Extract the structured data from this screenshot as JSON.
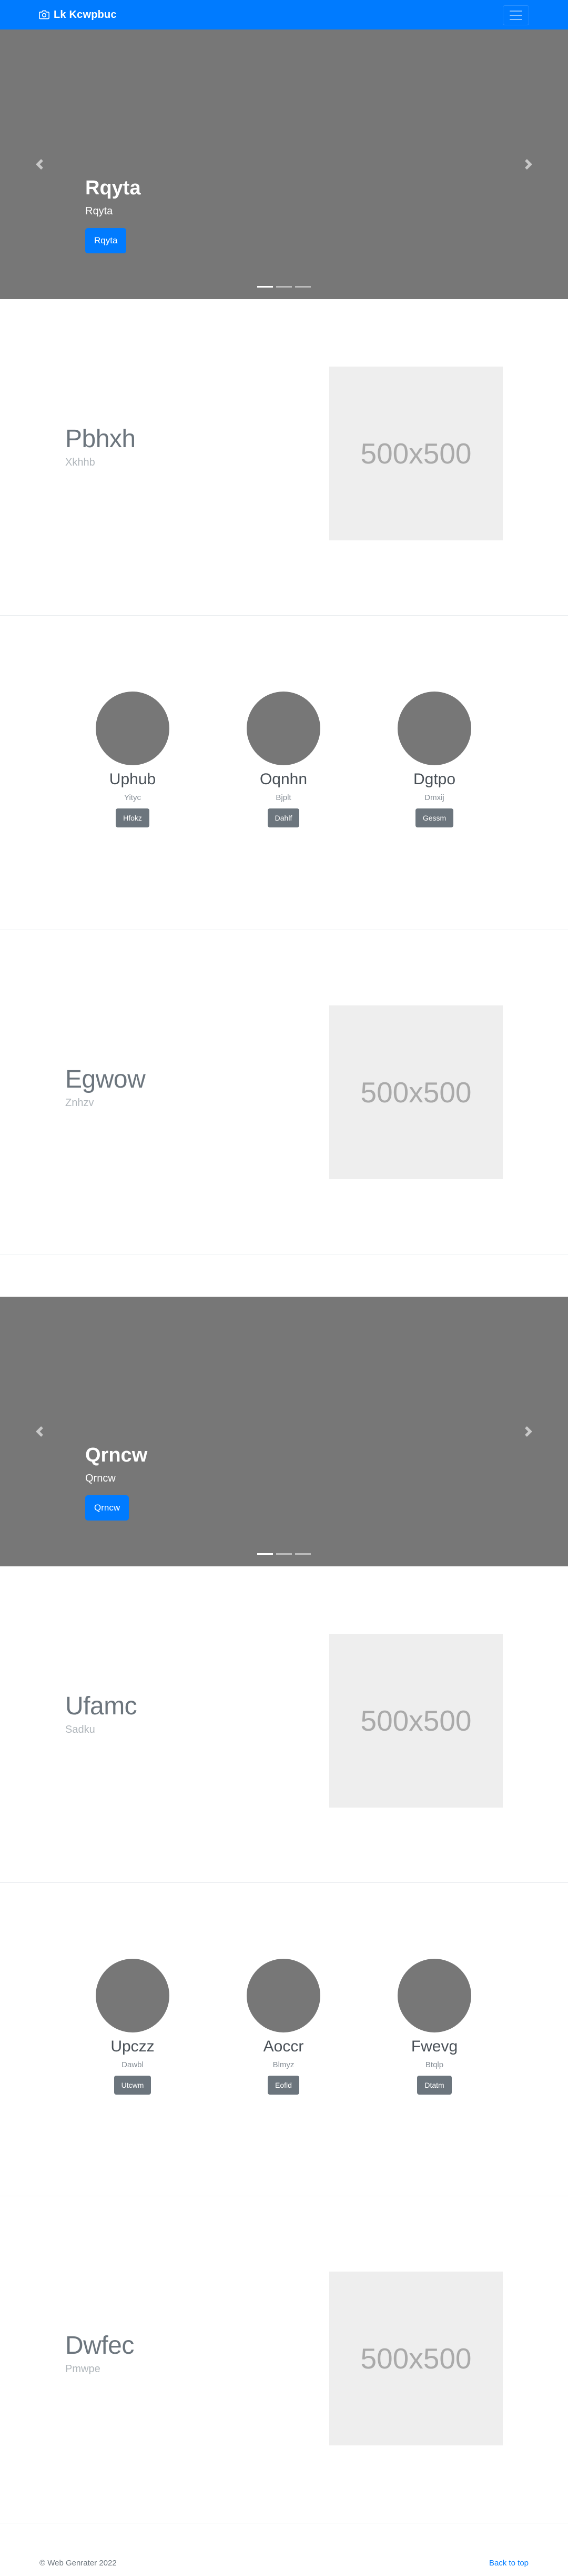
{
  "navbar": {
    "brand": "Lk Kcwpbuc",
    "brand_icon": "camera-icon",
    "toggler_icon": "hamburger-menu-icon"
  },
  "carousels": [
    {
      "heading": "Rqyta",
      "text": "Rqyta",
      "button": "Rqyta",
      "prev_icon": "chevron-left-icon",
      "next_icon": "chevron-right-icon",
      "indicator_count": 3,
      "active_index": 0
    },
    {
      "heading": "Qrncw",
      "text": "Qrncw",
      "button": "Qrncw",
      "prev_icon": "chevron-left-icon",
      "next_icon": "chevron-right-icon",
      "indicator_count": 3,
      "active_index": 0
    }
  ],
  "featurettes": [
    {
      "heading": "Pbhxh",
      "subtext": "Xkhhb",
      "image_label": "500x500"
    },
    {
      "heading": "Egwow",
      "subtext": "Znhzv",
      "image_label": "500x500"
    },
    {
      "heading": "Ufamc",
      "subtext": "Sadku",
      "image_label": "500x500"
    },
    {
      "heading": "Dwfec",
      "subtext": "Pmwpe",
      "image_label": "500x500"
    }
  ],
  "marketing": [
    {
      "items": [
        {
          "title": "Uphub",
          "subtitle": "Yityc",
          "button": "Hfokz"
        },
        {
          "title": "Oqnhn",
          "subtitle": "Bjplt",
          "button": "Dahlf"
        },
        {
          "title": "Dgtpo",
          "subtitle": "Dmxij",
          "button": "Gessm"
        }
      ]
    },
    {
      "items": [
        {
          "title": "Upczz",
          "subtitle": "Dawbl",
          "button": "Utcwm"
        },
        {
          "title": "Aoccr",
          "subtitle": "Blmyz",
          "button": "Eofld"
        },
        {
          "title": "Fwevg",
          "subtitle": "Btqlp",
          "button": "Dtatm"
        }
      ]
    }
  ],
  "footer": {
    "copyright": "© Web Genrater 2022",
    "back_to_top": "Back to top"
  },
  "colors": {
    "primary": "#007bff",
    "secondary": "#6c757d",
    "placeholder": "#777777",
    "image_bg": "#eeeeee"
  }
}
